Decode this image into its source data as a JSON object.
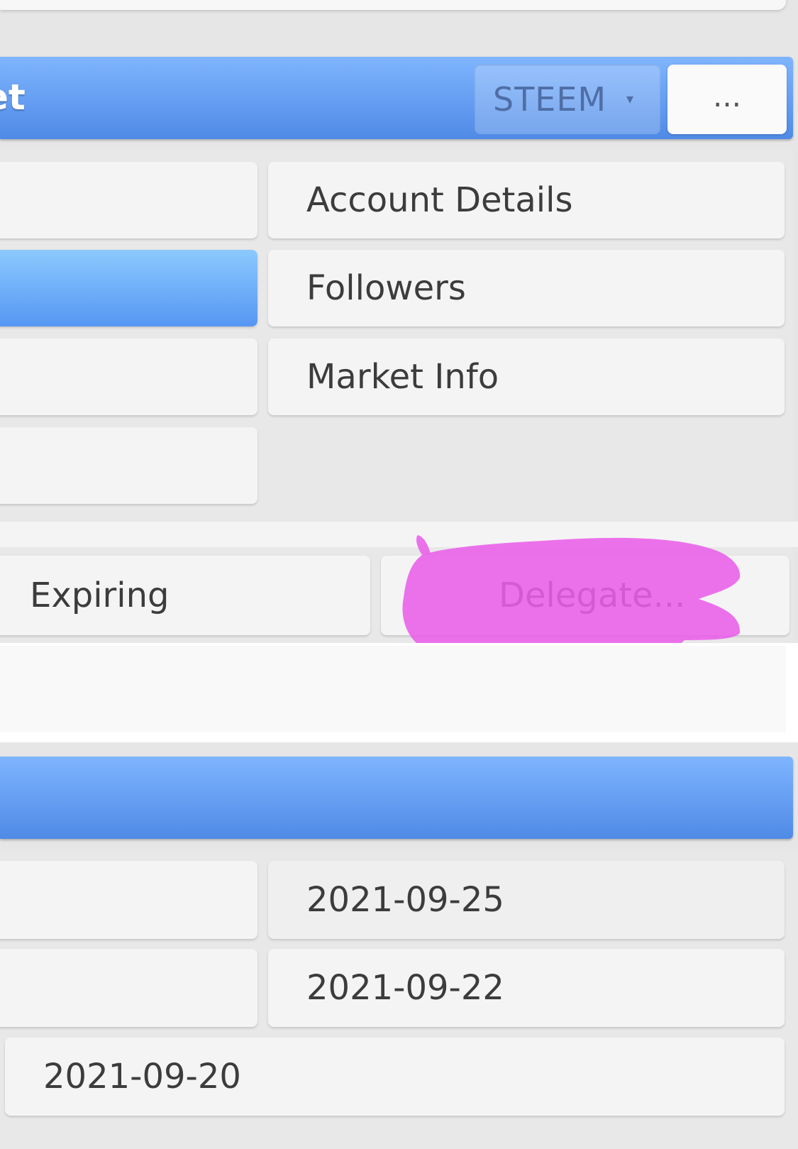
{
  "toolbar": {
    "title_fragment": "et",
    "currency_selected": "STEEM",
    "currency_arrow": "▾",
    "more_label": "..."
  },
  "menu": {
    "items": [
      {
        "label": ""
      },
      {
        "label": ""
      },
      {
        "label": ""
      },
      {
        "label": ""
      }
    ],
    "right_items": [
      {
        "label": "Account Details"
      },
      {
        "label": "Followers"
      },
      {
        "label": "Market Info"
      }
    ]
  },
  "actions": {
    "expiring_label": "Expiring",
    "delegate_label": "Delegate..."
  },
  "dates": {
    "rows": [
      "2021-09-25",
      "2021-09-22",
      "2021-09-20"
    ]
  },
  "colors": {
    "accent_blue": "#5597f2",
    "highlight_pink": "#e95fe9"
  }
}
